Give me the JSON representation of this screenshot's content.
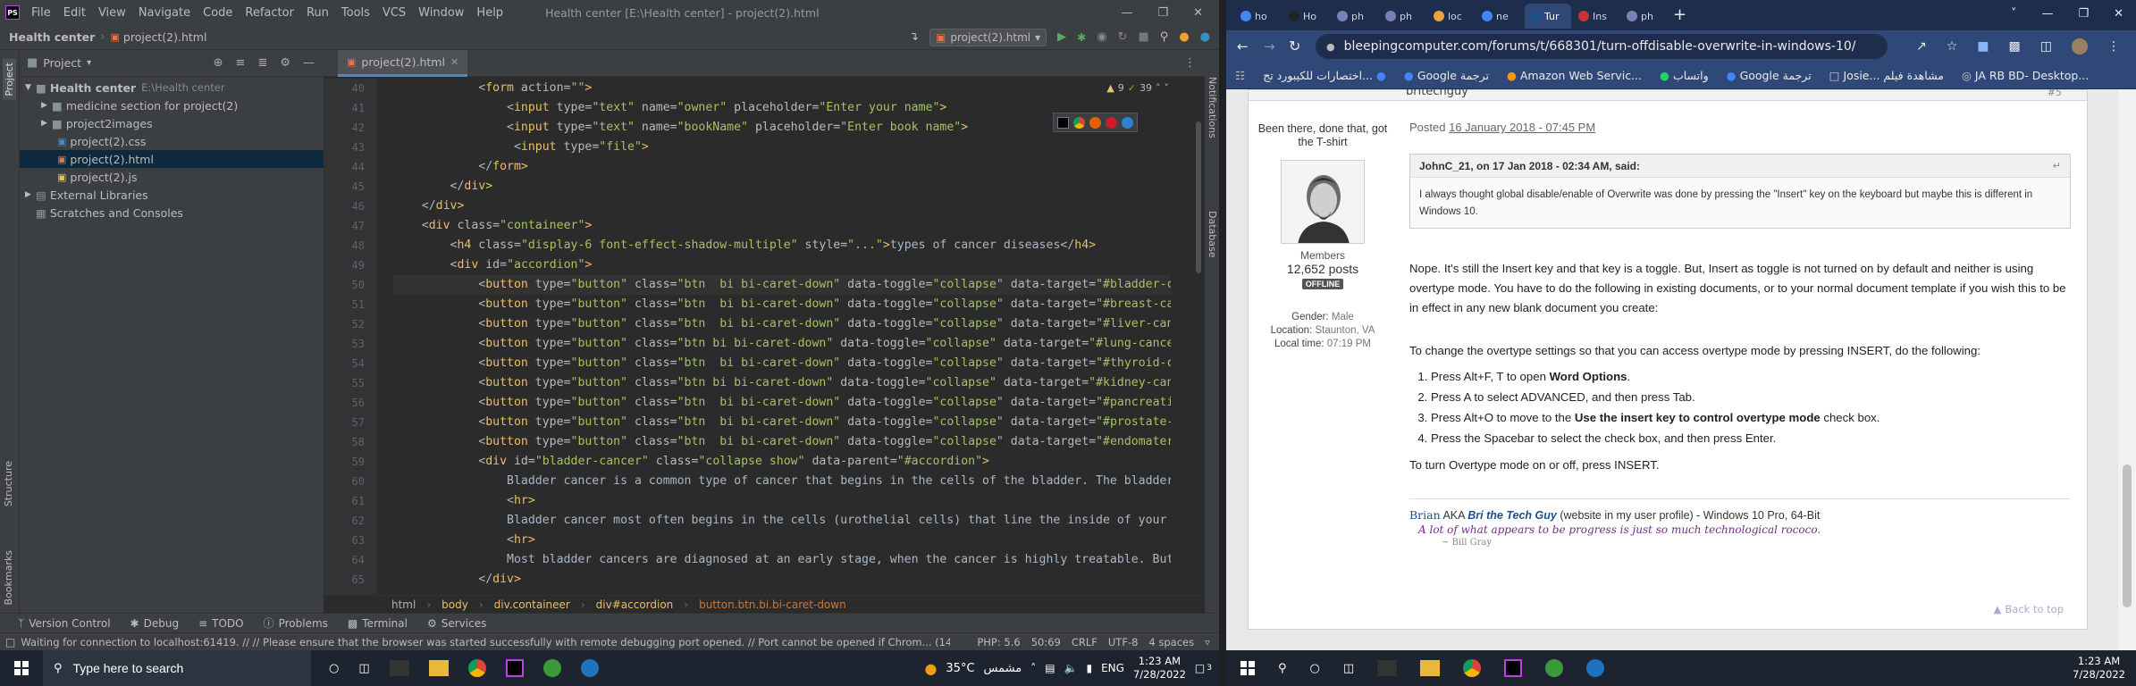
{
  "ide": {
    "menu": [
      "File",
      "Edit",
      "View",
      "Navigate",
      "Code",
      "Refactor",
      "Run",
      "Tools",
      "VCS",
      "Window",
      "Help"
    ],
    "window_title": "Health center [E:\\Health center] - project(2).html",
    "nav_project": "Health center",
    "nav_file": "project(2).html",
    "run_config": "project(2).html",
    "project_panel_title": "Project",
    "tree": {
      "root": "Health center",
      "root_path": "E:\\Health center",
      "items": [
        "medicine section for project(2)",
        "project2images",
        "project(2).css",
        "project(2).html",
        "project(2).js"
      ],
      "external": "External Libraries",
      "scratches": "Scratches and Consoles"
    },
    "editor_tab": "project(2).html",
    "inspections": {
      "warnings": "9",
      "weak": "39"
    },
    "line_numbers": [
      "40",
      "41",
      "42",
      "43",
      "44",
      "45",
      "46",
      "47",
      "48",
      "49",
      "50",
      "51",
      "52",
      "53",
      "54",
      "55",
      "56",
      "57",
      "58",
      "59",
      "60",
      "61",
      "62",
      "63",
      "64",
      "65"
    ],
    "code": [
      [
        [
          "t",
          "            <"
        ],
        [
          "g",
          "form "
        ],
        [
          "a",
          "action="
        ],
        [
          "v",
          "\"\""
        ],
        [
          "g",
          ">"
        ]
      ],
      [
        [
          "t",
          "                <"
        ],
        [
          "g",
          "input "
        ],
        [
          "a",
          "type="
        ],
        [
          "v",
          "\"text\" "
        ],
        [
          "a",
          "name="
        ],
        [
          "v",
          "\"owner\" "
        ],
        [
          "a",
          "placeholder="
        ],
        [
          "v",
          "\"Enter your name\""
        ],
        [
          "g",
          ">"
        ]
      ],
      [
        [
          "t",
          "                <"
        ],
        [
          "g",
          "input "
        ],
        [
          "a",
          "type="
        ],
        [
          "v",
          "\"text\" "
        ],
        [
          "a",
          "name="
        ],
        [
          "v",
          "\"bookName\" "
        ],
        [
          "a",
          "placeholder="
        ],
        [
          "v",
          "\"Enter book name\""
        ],
        [
          "g",
          ">"
        ]
      ],
      [
        [
          "t",
          "                 <"
        ],
        [
          "g",
          "input "
        ],
        [
          "a",
          "type="
        ],
        [
          "v",
          "\"file\""
        ],
        [
          "g",
          ">"
        ]
      ],
      [
        [
          "t",
          "            </"
        ],
        [
          "g",
          "form"
        ],
        [
          "g",
          ">"
        ]
      ],
      [
        [
          "t",
          "        </"
        ],
        [
          "g",
          "div"
        ],
        [
          "g",
          ">"
        ]
      ],
      [
        [
          "t",
          "    </"
        ],
        [
          "g",
          "div"
        ],
        [
          "g",
          ">"
        ]
      ],
      [
        [
          "t",
          "    <"
        ],
        [
          "g",
          "div "
        ],
        [
          "a",
          "class="
        ],
        [
          "v",
          "\"containeer\""
        ],
        [
          "g",
          ">"
        ]
      ],
      [
        [
          "t",
          "        <"
        ],
        [
          "g",
          "h4 "
        ],
        [
          "a",
          "class="
        ],
        [
          "v",
          "\"display-6 font-effect-shadow-multiple\" "
        ],
        [
          "a",
          "style="
        ],
        [
          "v",
          "\"...\""
        ],
        [
          "g",
          ">"
        ],
        [
          "t",
          "types of cancer diseases</"
        ],
        [
          "g",
          "h4"
        ],
        [
          "g",
          ">"
        ]
      ],
      [
        [
          "t",
          "        <"
        ],
        [
          "g",
          "div "
        ],
        [
          "a",
          "id="
        ],
        [
          "v",
          "\"accordion\""
        ],
        [
          "g",
          ">"
        ]
      ],
      [
        [
          "t",
          "            <"
        ],
        [
          "g",
          "button "
        ],
        [
          "a",
          "type="
        ],
        [
          "v",
          "\"button\" "
        ],
        [
          "a",
          "class="
        ],
        [
          "v",
          "\"btn  bi bi-caret-down\" "
        ],
        [
          "a",
          "data-toggle="
        ],
        [
          "v",
          "\"collapse\" "
        ],
        [
          "a",
          "data-target="
        ],
        [
          "v",
          "\"#bladder-cancer\""
        ]
      ],
      [
        [
          "t",
          "            <"
        ],
        [
          "g",
          "button "
        ],
        [
          "a",
          "type="
        ],
        [
          "v",
          "\"button\" "
        ],
        [
          "a",
          "class="
        ],
        [
          "v",
          "\"btn  bi bi-caret-down\" "
        ],
        [
          "a",
          "data-toggle="
        ],
        [
          "v",
          "\"collapse\" "
        ],
        [
          "a",
          "data-target="
        ],
        [
          "v",
          "\"#breast-cancer\""
        ]
      ],
      [
        [
          "t",
          "            <"
        ],
        [
          "g",
          "button "
        ],
        [
          "a",
          "type="
        ],
        [
          "v",
          "\"button\" "
        ],
        [
          "a",
          "class="
        ],
        [
          "v",
          "\"btn  bi bi-caret-down\" "
        ],
        [
          "a",
          "data-toggle="
        ],
        [
          "v",
          "\"collapse\" "
        ],
        [
          "a",
          "data-target="
        ],
        [
          "v",
          "\"#liver-cancer\""
        ]
      ],
      [
        [
          "t",
          "            <"
        ],
        [
          "g",
          "button "
        ],
        [
          "a",
          "type="
        ],
        [
          "v",
          "\"button\" "
        ],
        [
          "a",
          "class="
        ],
        [
          "v",
          "\"btn bi bi-caret-down\" "
        ],
        [
          "a",
          "data-toggle="
        ],
        [
          "v",
          "\"collapse\" "
        ],
        [
          "a",
          "data-target="
        ],
        [
          "v",
          "\"#lung-cancer\""
        ],
        [
          "t",
          ">L"
        ]
      ],
      [
        [
          "t",
          "            <"
        ],
        [
          "g",
          "button "
        ],
        [
          "a",
          "type="
        ],
        [
          "v",
          "\"button\" "
        ],
        [
          "a",
          "class="
        ],
        [
          "v",
          "\"btn  bi bi-caret-down\" "
        ],
        [
          "a",
          "data-toggle="
        ],
        [
          "v",
          "\"collapse\" "
        ],
        [
          "a",
          "data-target="
        ],
        [
          "v",
          "\"#thyroid-cancer\""
        ]
      ],
      [
        [
          "t",
          "            <"
        ],
        [
          "g",
          "button "
        ],
        [
          "a",
          "type="
        ],
        [
          "v",
          "\"button\" "
        ],
        [
          "a",
          "class="
        ],
        [
          "v",
          "\"btn bi bi-caret-down\" "
        ],
        [
          "a",
          "data-toggle="
        ],
        [
          "v",
          "\"collapse\" "
        ],
        [
          "a",
          "data-target="
        ],
        [
          "v",
          "\"#kidney-cancer\""
        ]
      ],
      [
        [
          "t",
          "            <"
        ],
        [
          "g",
          "button "
        ],
        [
          "a",
          "type="
        ],
        [
          "v",
          "\"button\" "
        ],
        [
          "a",
          "class="
        ],
        [
          "v",
          "\"btn  bi bi-caret-down\" "
        ],
        [
          "a",
          "data-toggle="
        ],
        [
          "v",
          "\"collapse\" "
        ],
        [
          "a",
          "data-target="
        ],
        [
          "v",
          "\"#pancreatic-cancer\""
        ]
      ],
      [
        [
          "t",
          "            <"
        ],
        [
          "g",
          "button "
        ],
        [
          "a",
          "type="
        ],
        [
          "v",
          "\"button\" "
        ],
        [
          "a",
          "class="
        ],
        [
          "v",
          "\"btn  bi bi-caret-down\" "
        ],
        [
          "a",
          "data-toggle="
        ],
        [
          "v",
          "\"collapse\" "
        ],
        [
          "a",
          "data-target="
        ],
        [
          "v",
          "\"#prostate-cancer\""
        ]
      ],
      [
        [
          "t",
          "            <"
        ],
        [
          "g",
          "button "
        ],
        [
          "a",
          "type="
        ],
        [
          "v",
          "\"button\" "
        ],
        [
          "a",
          "class="
        ],
        [
          "v",
          "\"btn  bi bi-caret-down\" "
        ],
        [
          "a",
          "data-toggle="
        ],
        [
          "v",
          "\"collapse\" "
        ],
        [
          "a",
          "data-target="
        ],
        [
          "v",
          "\"#endomaterial-cancer\""
        ]
      ],
      [
        [
          "t",
          "            <"
        ],
        [
          "g",
          "div "
        ],
        [
          "a",
          "id="
        ],
        [
          "v",
          "\"bladder-cancer\" "
        ],
        [
          "a",
          "class="
        ],
        [
          "v",
          "\"collapse show\" "
        ],
        [
          "a",
          "data-parent="
        ],
        [
          "v",
          "\"#accordion\""
        ],
        [
          "g",
          ">"
        ]
      ],
      [
        [
          "t",
          "                Bladder cancer is a common type of cancer that begins in the cells of the bladder. The bladder is"
        ]
      ],
      [
        [
          "t",
          "                <"
        ],
        [
          "g",
          "hr"
        ],
        [
          "g",
          ">"
        ]
      ],
      [
        [
          "t",
          "                Bladder cancer most often begins in the cells (urothelial cells) that line the inside of your blad"
        ]
      ],
      [
        [
          "t",
          "                <"
        ],
        [
          "g",
          "hr"
        ],
        [
          "g",
          ">"
        ]
      ],
      [
        [
          "t",
          "                Most bladder cancers are diagnosed at an early stage, when the cancer is highly treatable. But eve"
        ]
      ],
      [
        [
          "t",
          "            </"
        ],
        [
          "g",
          "div"
        ],
        [
          "g",
          ">"
        ]
      ]
    ],
    "breadcrumb": [
      "html",
      "body",
      "div.containeer",
      "div#accordion",
      "button.btn.bi.bi-caret-down"
    ],
    "toolwindows": [
      "Version Control",
      "Debug",
      "TODO",
      "Problems",
      "Terminal",
      "Services"
    ],
    "left_strip": [
      "Project",
      "Structure",
      "Bookmarks"
    ],
    "right_strip": [
      "Notifications",
      "Database"
    ],
    "status_message": "Waiting for connection to localhost:61419. // // Please ensure that the browser was started successfully with remote debugging port opened. // Port cannot be opened if Chrom... (14 minutes ago)",
    "status_right": [
      "PHP: 5.6",
      "50:69",
      "CRLF",
      "UTF-8",
      "4 spaces"
    ]
  },
  "chrome": {
    "tabs": [
      "ho",
      "Ho",
      "ph",
      "ph",
      "loc",
      "ne",
      "Tur",
      "Ins",
      "ph"
    ],
    "active_tab_index": 6,
    "url": "bleepingcomputer.com/forums/t/668301/turn-offdisable-overwrite-in-windows-10/",
    "bookmarks": [
      "اختصارات للكيبورد تج...",
      "Google ترجمة",
      "Amazon Web Servic...",
      "واتساب",
      "Google ترجمة",
      "Josie... مشاهدة فيلم",
      "JA RB  BD- Desktop..."
    ],
    "post": {
      "username": "britechguy",
      "user_title": "Been there, done that, got the T-shirt",
      "group": "Members",
      "posts": "12,652 posts",
      "status": "OFFLINE",
      "gender_label": "Gender:",
      "gender": "Male",
      "location_label": "Location:",
      "location": "Staunton, VA",
      "localtime_label": "Local time:",
      "localtime": "07:19 PM",
      "posted_label": "Posted",
      "posted_date": "16 January 2018 - 07:45 PM",
      "post_number": "#5",
      "quote_header": "JohnC_21, on 17 Jan 2018 - 02:34 AM, said:",
      "quote_text": "I always thought global disable/enable of Overwrite was done by pressing the \"Insert\" key on the keyboard but maybe this is different in Windows 10.",
      "para1": "Nope.  It's still the Insert key and that key is a toggle.  But, Insert as toggle is not turned on by default and neither is using overtype mode.  You have to do the following in existing documents, or to your normal document template if you wish this to be in effect in any new blank document you create:",
      "para2": "To change the overtype settings so that you can access overtype mode by pressing INSERT, do the following:",
      "steps": [
        {
          "pre": "Press Alt+F, T to open ",
          "bold": "Word Options",
          "post": "."
        },
        {
          "pre": "Press A to select ADVANCED, and then press Tab.",
          "bold": "",
          "post": ""
        },
        {
          "pre": "Press Alt+O to move to the ",
          "bold": "Use the insert key to control overtype mode",
          "post": " check box."
        },
        {
          "pre": "Press the Spacebar to select the check box, and then press Enter.",
          "bold": "",
          "post": ""
        }
      ],
      "para3": "To turn Overtype mode on or off, press INSERT.",
      "sig_name": "Brian",
      "sig_aka": "AKA",
      "sig_nick": "Bri the Tech Guy",
      "sig_rest": "(website in my user profile) - Windows 10 Pro, 64-Bit",
      "sig_quote": "A lot of what appears to be progress is just so much technological rococo.",
      "sig_author": "~ Bill Gray",
      "back_to_top": "Back to top"
    }
  },
  "taskbar": {
    "search_placeholder": "Type here to search",
    "weather": "35°C",
    "weather_desc": "مشمس",
    "lang": "ENG",
    "time": "1:23 AM",
    "date": "7/28/2022",
    "notif_count": "3"
  },
  "colors": {
    "ide_bg": "#2b2b2b",
    "ide_panel": "#3c3f41",
    "tag": "#e8bf6a",
    "value": "#a5c261",
    "chrome_frame": "#1f2d4d",
    "link": "#1f4e8c"
  }
}
